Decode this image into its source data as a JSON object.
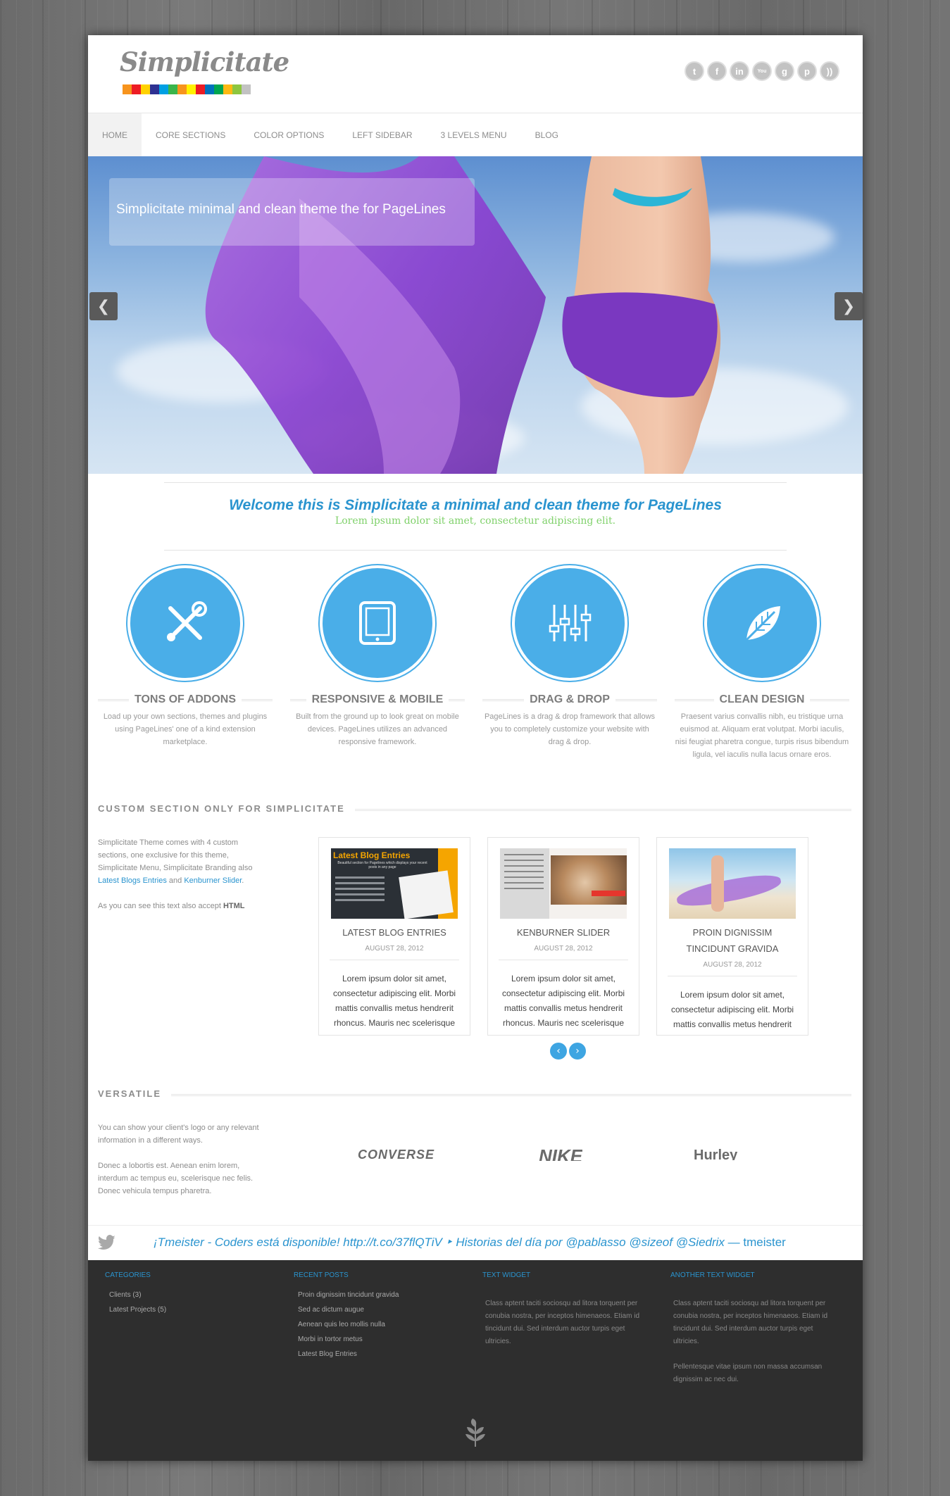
{
  "logo": {
    "text": "Simplicitate",
    "bar_colors": [
      "#f7941d",
      "#ed1c24",
      "#ffd200",
      "#2e3192",
      "#00a0e3",
      "#39b54a",
      "#f7941d",
      "#fff200",
      "#ed1c24",
      "#0072bc",
      "#00a651",
      "#fdb913",
      "#8dc63f",
      "#c2c2c2"
    ]
  },
  "social": [
    {
      "icon": "twitter-icon",
      "glyph": "t"
    },
    {
      "icon": "facebook-icon",
      "glyph": "f"
    },
    {
      "icon": "linkedin-icon",
      "glyph": "in"
    },
    {
      "icon": "youtube-icon",
      "glyph": "You"
    },
    {
      "icon": "googleplus-icon",
      "glyph": "g"
    },
    {
      "icon": "pinterest-icon",
      "glyph": "p"
    },
    {
      "icon": "rss-icon",
      "glyph": "))"
    }
  ],
  "nav": [
    "HOME",
    "CORE SECTIONS",
    "COLOR OPTIONS",
    "LEFT SIDEBAR",
    "3 LEVELS MENU",
    "BLOG"
  ],
  "slider": {
    "caption": "Simplicitate minimal and clean theme the for PageLines",
    "prev_icon": "chevron-left-icon",
    "next_icon": "chevron-right-icon"
  },
  "welcome": {
    "title": "Welcome this is Simplicitate a minimal and clean theme for PageLines",
    "subtitle": "Lorem ipsum dolor sit amet, consectetur adipiscing elit."
  },
  "features": [
    {
      "icon": "tools-icon",
      "title": "TONS OF ADDONS",
      "text": "Load up your own sections, themes and plugins using PageLines' one of a kind extension marketplace."
    },
    {
      "icon": "tablet-icon",
      "title": "RESPONSIVE & MOBILE",
      "text": "Built from the ground up to look great on mobile devices. PageLines utilizes an advanced responsive framework."
    },
    {
      "icon": "sliders-icon",
      "title": "DRAG & DROP",
      "text": "PageLines is a drag & drop framework that allows you to completely customize your website with drag & drop."
    },
    {
      "icon": "leaf-icon",
      "title": "CLEAN DESIGN",
      "text": "Praesent varius convallis nibh, eu tristique urna euismod at. Aliquam erat volutpat. Morbi iaculis, nisi feugiat pharetra congue, turpis risus bibendum ligula, vel iaculis nulla lacus ornare eros."
    }
  ],
  "custom_section": {
    "heading": "CUSTOM SECTION ONLY FOR SIMPLICITATE",
    "intro": "Simplicitate Theme comes with 4 custom sections, one exclusive for this theme, Simplicitate Menu, Simplicitate Branding also",
    "link1": "Latest Blogs Entries",
    "and": "and",
    "link2": "Kenburner Slider",
    "period": ".",
    "accept_prefix": "As you can see this text also accept",
    "accept_html": "HTML"
  },
  "posts": [
    {
      "title": "LATEST BLOG ENTRIES",
      "date": "AUGUST 28, 2012",
      "excerpt": "Lorem ipsum dolor sit amet, consectetur adipiscing elit. Morbi mattis convallis metus hendrerit rhoncus. Mauris nec scelerisque",
      "thumb_title": "Latest Blog Entries",
      "thumb_subtitle": "Beautiful section for Pagelines which displays your recent posts in any page"
    },
    {
      "title": "KENBURNER SLIDER",
      "date": "AUGUST 28, 2012",
      "excerpt": "Lorem ipsum dolor sit amet, consectetur adipiscing elit. Morbi mattis convallis metus hendrerit rhoncus. Mauris nec scelerisque"
    },
    {
      "title": "PROIN DIGNISSIM TINCIDUNT GRAVIDA",
      "date": "AUGUST 28, 2012",
      "excerpt": "Lorem ipsum dolor sit amet, consectetur adipiscing elit. Morbi mattis convallis metus hendrerit"
    }
  ],
  "carousel": {
    "prev_icon": "chevron-left-icon",
    "next_icon": "chevron-right-icon"
  },
  "versatile": {
    "heading": "VERSATILE",
    "p1": "You can show your client's logo or any relevant information in a different ways.",
    "p2": "Donec a lobortis est. Aenean enim lorem, interdum ac tempus eu, scelerisque nec felis. Donec vehicula tempus pharetra.",
    "brands": [
      "CONVERSE",
      "NIKE",
      "Hurley"
    ]
  },
  "tweet": {
    "text": "¡Tmeister - Coders está disponible! http://t.co/37flQTiV ‣ Historias del día por @pablasso @sizeof @Siedrix",
    "author": "— tmeister"
  },
  "footer": {
    "categories": {
      "heading": "CATEGORIES",
      "items": [
        "Clients (3)",
        "Latest Projects (5)"
      ]
    },
    "recent_posts": {
      "heading": "RECENT POSTS",
      "items": [
        "Proin dignissim tincidunt gravida",
        "Sed ac dictum augue",
        "Aenean quis leo mollis nulla",
        "Morbi in tortor metus",
        "Latest Blog Entries"
      ]
    },
    "text_widget": {
      "heading": "TEXT WIDGET",
      "text": "Class aptent taciti sociosqu ad litora torquent per conubia nostra, per inceptos himenaeos. Etiam id tincidunt dui. Sed interdum auctor turpis eget ultricies."
    },
    "another_text_widget": {
      "heading": "ANOTHER TEXT WIDGET",
      "text": "Class aptent taciti sociosqu ad litora torquent per conubia nostra, per inceptos himenaeos. Etiam id tincidunt dui. Sed interdum auctor turpis eget ultricies.",
      "text2": "Pellentesque vitae ipsum non massa accumsan dignissim ac nec dui."
    }
  },
  "colors": {
    "accent": "#2a94cf",
    "circle": "#4aaee8",
    "footer_bg": "#2e2e2e",
    "welcome_sub": "#7fd16a"
  }
}
